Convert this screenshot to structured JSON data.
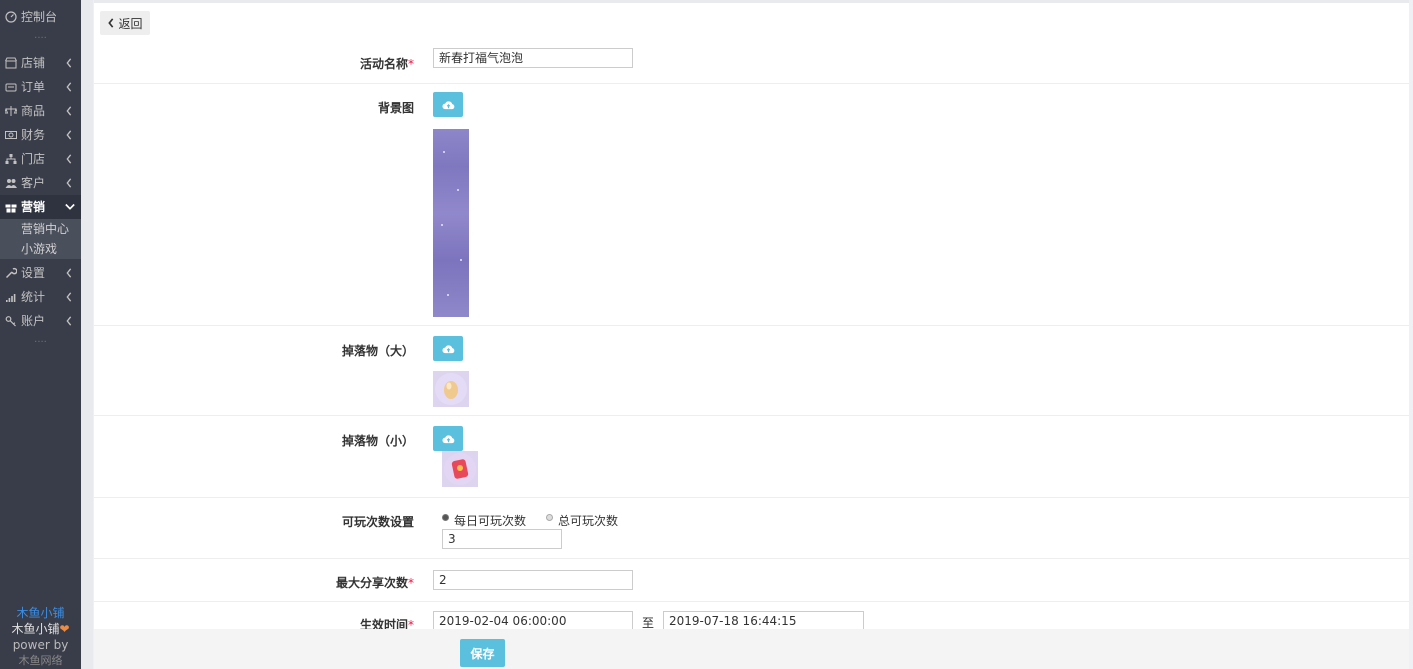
{
  "sidebar": {
    "items": [
      {
        "label": "控制台",
        "icon": "dashboard-icon"
      },
      {
        "label": "店铺",
        "icon": "shop-icon"
      },
      {
        "label": "订单",
        "icon": "order-icon"
      },
      {
        "label": "商品",
        "icon": "goods-icon"
      },
      {
        "label": "财务",
        "icon": "finance-icon"
      },
      {
        "label": "门店",
        "icon": "store-icon"
      },
      {
        "label": "客户",
        "icon": "customer-icon"
      },
      {
        "label": "营销",
        "icon": "marketing-icon"
      },
      {
        "label": "设置",
        "icon": "wrench-icon"
      },
      {
        "label": "统计",
        "icon": "stats-icon"
      },
      {
        "label": "账户",
        "icon": "key-icon"
      }
    ],
    "sub_items": [
      "营销中心",
      "小游戏"
    ],
    "dots": "....",
    "brand": {
      "line1": "木鱼小铺",
      "line2": "木鱼小铺",
      "heart": "❤",
      "line3": "power by",
      "line4": "木鱼网络"
    },
    "colors": {
      "bg": "#393d49",
      "brand_blue": "#3a8ee6",
      "heart": "#f08a3c"
    }
  },
  "header": {
    "back_label": "返回"
  },
  "form": {
    "name": {
      "label": "活动名称",
      "required_mark": "*",
      "value": "新春打福气泡泡"
    },
    "background": {
      "label": "背景图"
    },
    "drop_large": {
      "label": "掉落物（大）"
    },
    "drop_small": {
      "label": "掉落物（小）"
    },
    "play_count": {
      "label": "可玩次数设置",
      "options": [
        "每日可玩次数",
        "总可玩次数"
      ],
      "selected": 0,
      "value": "3"
    },
    "max_share": {
      "label": "最大分享次数",
      "required_mark": "*",
      "value": "2"
    },
    "valid_time": {
      "label": "生效时间",
      "required_mark": "*",
      "start": "2019-02-04 06:00:00",
      "separator": "至",
      "end": "2019-07-18 16:44:15"
    }
  },
  "footer": {
    "save_label": "保存"
  },
  "accent_color": "#5bc0de"
}
